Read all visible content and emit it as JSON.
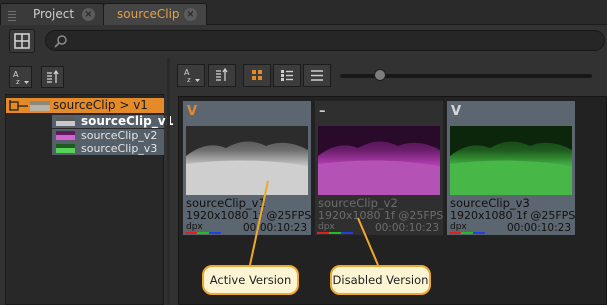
{
  "tabs": [
    {
      "label": "Project",
      "active": false
    },
    {
      "label": "sourceClip",
      "active": true
    }
  ],
  "search": {
    "value": "",
    "placeholder": ""
  },
  "tree": {
    "root": {
      "label": "sourceClip > v1"
    },
    "items": [
      {
        "label": "sourceClip_v1",
        "active": true
      },
      {
        "label": "sourceClip_v2",
        "active": false
      },
      {
        "label": "sourceClip_v3",
        "active": false
      }
    ]
  },
  "clips": [
    {
      "marker": "V",
      "name": "sourceClip_v1",
      "meta": "1920x1080  1f @25FPS",
      "format": "dpx",
      "duration": "00:00:10:23",
      "state": "active",
      "tint": "grey"
    },
    {
      "marker": "–",
      "name": "sourceClip_v2",
      "meta": "1920x1080  1f @25FPS",
      "format": "dpx",
      "duration": "00:00:10:23",
      "state": "disabled",
      "tint": "magenta"
    },
    {
      "marker": "V",
      "name": "sourceClip_v3",
      "meta": "1920x1080  1f @25FPS",
      "format": "dpx",
      "duration": "00:00:10:23",
      "state": "normal",
      "tint": "green"
    }
  ],
  "thumbnail_size": {
    "level": 0.14
  },
  "callouts": {
    "active": "Active Version",
    "disabled": "Disabled Version"
  },
  "colors": {
    "accent_orange": "#e48a28",
    "callout_fill": "#fbf5d4",
    "callout_border": "#efa82c"
  },
  "icons": [
    "grid-layout-icon",
    "search-icon",
    "sort-alpha-icon",
    "sort-order-icon",
    "view-large-thumbnails-icon",
    "view-small-thumbnails-icon",
    "view-list-icon",
    "clip-icon",
    "close-icon"
  ]
}
